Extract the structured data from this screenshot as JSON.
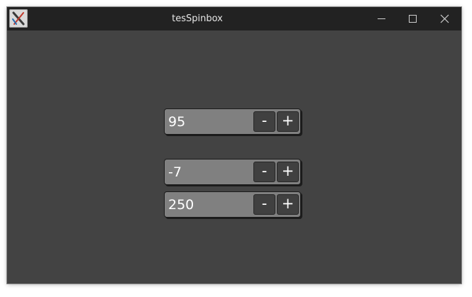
{
  "window": {
    "title": "tesSpinbox"
  },
  "titlebar": {
    "app_icon": "x-app-icon",
    "controls": [
      "minimize-icon",
      "maximize-icon",
      "close-icon"
    ]
  },
  "spinboxes": [
    {
      "value": "95",
      "minus_label": "-",
      "plus_label": "+"
    },
    {
      "value": "-7",
      "minus_label": "-",
      "plus_label": "+"
    },
    {
      "value": "250",
      "minus_label": "-",
      "plus_label": "+"
    }
  ],
  "colors": {
    "window_background": "#434343",
    "titlebar_background": "#222222",
    "spinbox_field": "#808080",
    "spin_button": "#404040",
    "text": "#ffffff"
  }
}
